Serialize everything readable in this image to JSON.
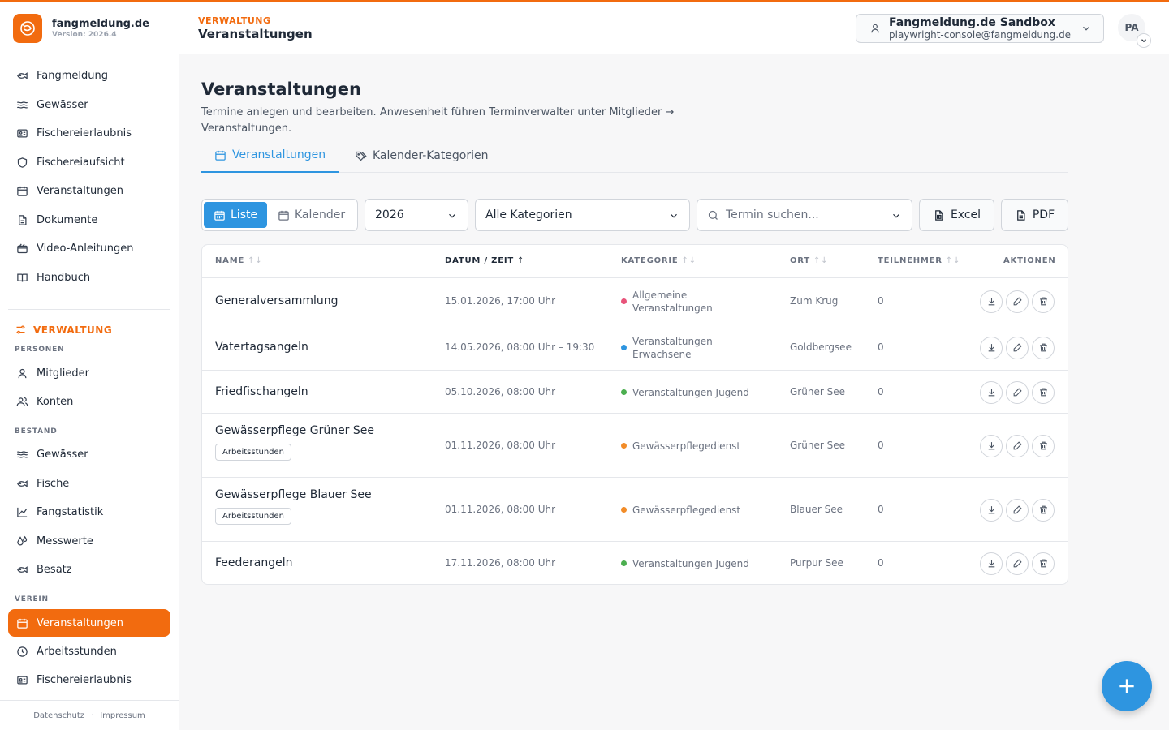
{
  "brand": {
    "name": "fangmeldung.de",
    "version": "Version: 2026.4"
  },
  "header": {
    "kicker": "VERWALTUNG",
    "title": "Veranstaltungen"
  },
  "tenant": {
    "name": "Fangmeldung.de Sandbox",
    "email": "playwright-console@fangmeldung.de"
  },
  "user": {
    "initials": "PA"
  },
  "sidebar": {
    "main": [
      {
        "label": "Fangmeldung",
        "icon": "fish-icon"
      },
      {
        "label": "Gewässer",
        "icon": "waves-icon"
      },
      {
        "label": "Fischereierlaubnis",
        "icon": "id-card-icon"
      },
      {
        "label": "Fischereiaufsicht",
        "icon": "shield-icon"
      },
      {
        "label": "Veranstaltungen",
        "icon": "calendar-icon"
      },
      {
        "label": "Dokumente",
        "icon": "document-icon"
      },
      {
        "label": "Video-Anleitungen",
        "icon": "video-icon"
      },
      {
        "label": "Handbuch",
        "icon": "book-icon"
      }
    ],
    "admin_label": "VERWALTUNG",
    "group_personen": "PERSONEN",
    "personen": [
      {
        "label": "Mitglieder",
        "icon": "user-icon"
      },
      {
        "label": "Konten",
        "icon": "users-icon"
      }
    ],
    "group_bestand": "BESTAND",
    "bestand": [
      {
        "label": "Gewässer",
        "icon": "waves-icon"
      },
      {
        "label": "Fische",
        "icon": "fish-icon"
      },
      {
        "label": "Fangstatistik",
        "icon": "chart-icon"
      },
      {
        "label": "Messwerte",
        "icon": "drops-icon"
      },
      {
        "label": "Besatz",
        "icon": "fish-icon"
      }
    ],
    "group_verein": "VEREIN",
    "verein": [
      {
        "label": "Veranstaltungen",
        "icon": "calendar-icon",
        "active": true
      },
      {
        "label": "Arbeitsstunden",
        "icon": "clock-icon"
      },
      {
        "label": "Fischereierlaubnis",
        "icon": "id-card-icon"
      }
    ],
    "footer": {
      "privacy": "Datenschutz",
      "imprint": "Impressum"
    }
  },
  "page": {
    "title": "Veranstaltungen",
    "subtitle": "Termine anlegen und bearbeiten. Anwesenheit führen Terminverwalter unter Mitglieder → Veranstaltungen.",
    "tabs": [
      {
        "label": "Veranstaltungen",
        "active": true
      },
      {
        "label": "Kalender-Kategorien",
        "active": false
      }
    ]
  },
  "toolbar": {
    "view_list": "Liste",
    "view_calendar": "Kalender",
    "year": "2026",
    "category": "Alle Kategorien",
    "search_placeholder": "Termin suchen...",
    "excel": "Excel",
    "pdf": "PDF"
  },
  "table": {
    "headers": {
      "name": "NAME",
      "date": "DATUM / ZEIT",
      "category": "KATEGORIE",
      "place": "ORT",
      "participants": "TEILNEHMER",
      "actions": "AKTIONEN"
    },
    "rows": [
      {
        "name": "Generalversammlung",
        "tag": "",
        "date": "15.01.2026, 17:00 Uhr",
        "category_line1": "Allgemeine",
        "category_line2": "Veranstaltungen",
        "category_color": "#e8537a",
        "place": "Zum Krug",
        "participants": "0"
      },
      {
        "name": "Vatertagsangeln",
        "tag": "",
        "date": "14.05.2026, 08:00 Uhr – 19:30",
        "category_line1": "Veranstaltungen",
        "category_line2": "Erwachsene",
        "category_color": "#2e95e0",
        "place": "Goldbergsee",
        "participants": "0"
      },
      {
        "name": "Friedfischangeln",
        "tag": "",
        "date": "05.10.2026, 08:00 Uhr",
        "category_line1": "Veranstaltungen Jugend",
        "category_line2": "",
        "category_color": "#4caf50",
        "place": "Grüner See",
        "participants": "0"
      },
      {
        "name": "Gewässerpflege Grüner See",
        "tag": "Arbeitsstunden",
        "date": "01.11.2026, 08:00 Uhr",
        "category_line1": "Gewässerpflegedienst",
        "category_line2": "",
        "category_color": "#f28c28",
        "place": "Grüner See",
        "participants": "0"
      },
      {
        "name": "Gewässerpflege Blauer See",
        "tag": "Arbeitsstunden",
        "date": "01.11.2026, 08:00 Uhr",
        "category_line1": "Gewässerpflegedienst",
        "category_line2": "",
        "category_color": "#f28c28",
        "place": "Blauer See",
        "participants": "0"
      },
      {
        "name": "Feederangeln",
        "tag": "",
        "date": "17.11.2026, 08:00 Uhr",
        "category_line1": "Veranstaltungen Jugend",
        "category_line2": "",
        "category_color": "#4caf50",
        "place": "Purpur See",
        "participants": "0"
      }
    ]
  },
  "colors": {
    "brand": "#f26b0f",
    "accent": "#2e95e0"
  }
}
